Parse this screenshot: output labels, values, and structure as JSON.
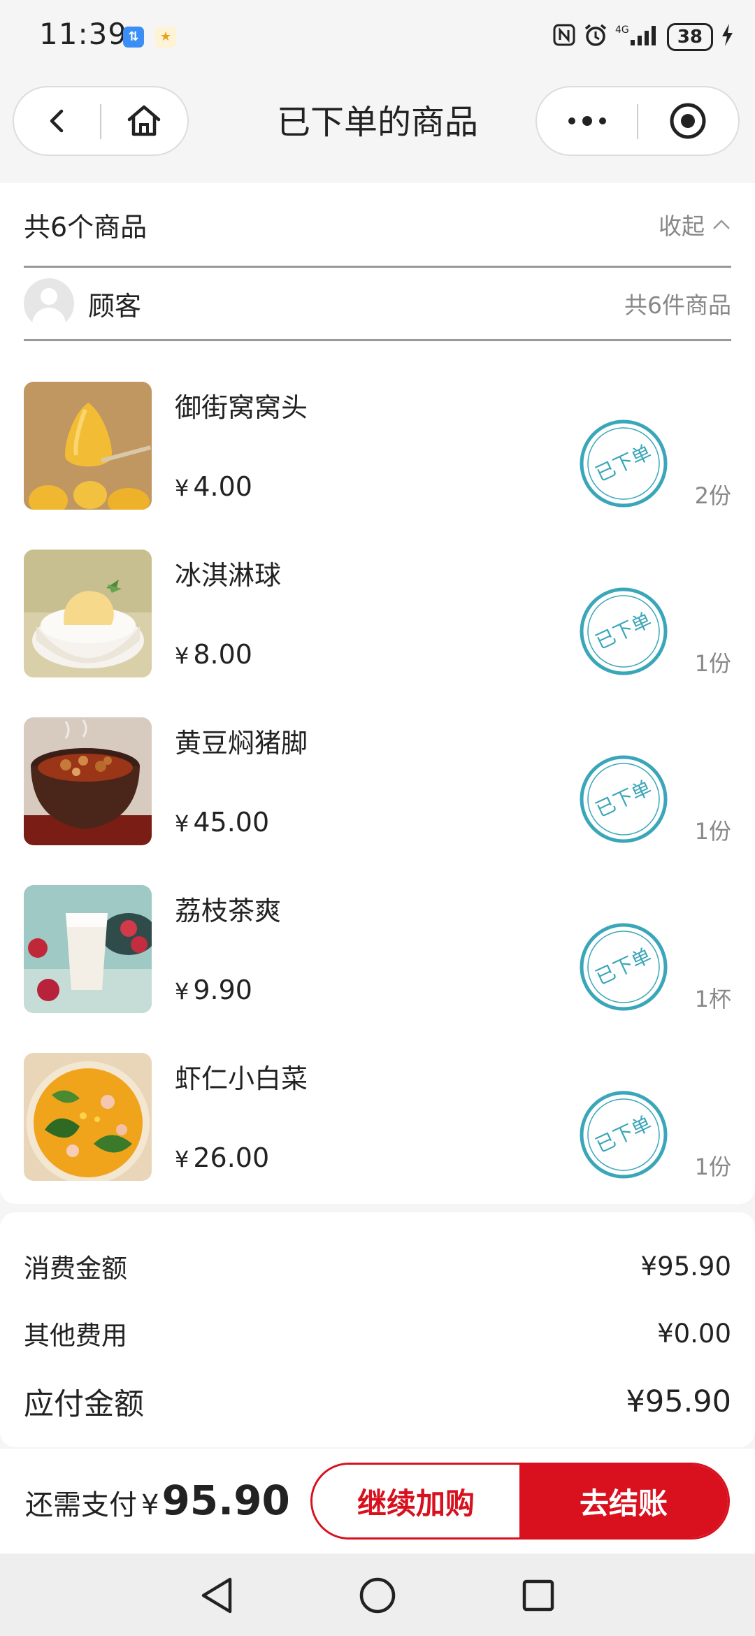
{
  "status_bar": {
    "time": "11:39",
    "battery": "38",
    "network": "4G"
  },
  "nav": {
    "title": "已下单的商品"
  },
  "summary": {
    "title": "共6个商品",
    "collapse_label": "收起"
  },
  "customer": {
    "name": "顾客",
    "count": "共6件商品"
  },
  "items": [
    {
      "name": "御街窝窝头",
      "currency": "¥",
      "price": "4.00",
      "qty": "2份",
      "stamp": "已下单"
    },
    {
      "name": "冰淇淋球",
      "currency": "¥",
      "price": "8.00",
      "qty": "1份",
      "stamp": "已下单"
    },
    {
      "name": "黄豆焖猪脚",
      "currency": "¥",
      "price": "45.00",
      "qty": "1份",
      "stamp": "已下单"
    },
    {
      "name": "荔枝茶爽",
      "currency": "¥",
      "price": "9.90",
      "qty": "1杯",
      "stamp": "已下单"
    },
    {
      "name": "虾仁小白菜",
      "currency": "¥",
      "price": "26.00",
      "qty": "1份",
      "stamp": "已下单"
    }
  ],
  "totals": {
    "consumption_label": "消费金额",
    "consumption_value": "¥95.90",
    "other_label": "其他费用",
    "other_value": "¥0.00",
    "payable_label": "应付金额",
    "payable_value": "¥95.90"
  },
  "bottom": {
    "remain_label": "还需支付",
    "currency": "¥",
    "remain_amount": "95.90",
    "add_more_label": "继续加购",
    "checkout_label": "去结账"
  },
  "colors": {
    "accent": "#d9101e",
    "stamp": "#3aa6b9"
  }
}
